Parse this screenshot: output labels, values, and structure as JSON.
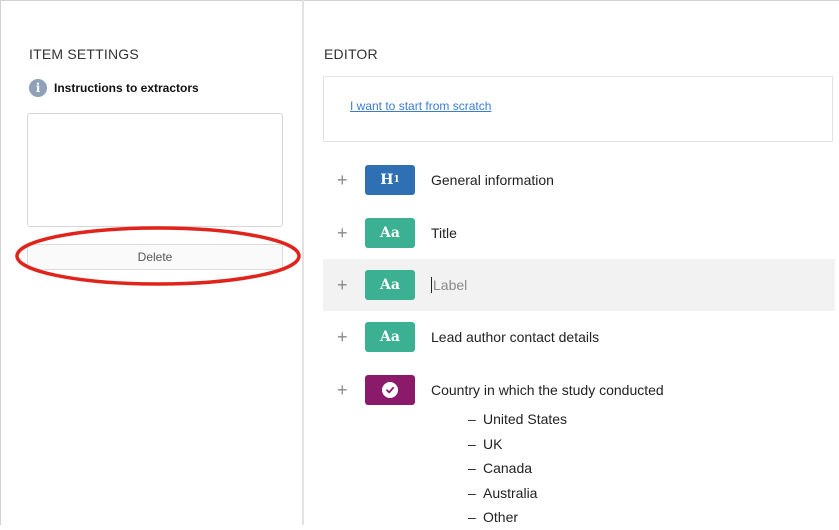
{
  "settings": {
    "title": "ITEM SETTINGS",
    "instructions_label": "Instructions to extractors",
    "instructions_value": "",
    "delete_label": "Delete"
  },
  "editor": {
    "title": "EDITOR",
    "start_link": "I want to start from scratch",
    "rows": [
      {
        "chip": "H1",
        "label": "General information"
      },
      {
        "chip": "Aa",
        "label": "Title"
      },
      {
        "chip": "Aa",
        "label": "",
        "placeholder": "Label"
      },
      {
        "chip": "Aa",
        "label": "Lead author contact details"
      },
      {
        "chip": "",
        "label": "Country in which the study conducted"
      }
    ],
    "add_symbol": "+",
    "country_options": [
      "United States",
      "UK",
      "Canada",
      "Australia",
      "Other"
    ],
    "option_dash": "–"
  },
  "colors": {
    "heading_chip": "#2f6fb3",
    "text_chip": "#3bb092",
    "choice_chip": "#8c1a6a",
    "annotation": "#e0241b"
  },
  "icons": {
    "info": "info-icon",
    "add": "plus-icon",
    "heading": "heading-type-icon",
    "text": "text-type-icon",
    "choice": "checkmark-circle-icon"
  }
}
